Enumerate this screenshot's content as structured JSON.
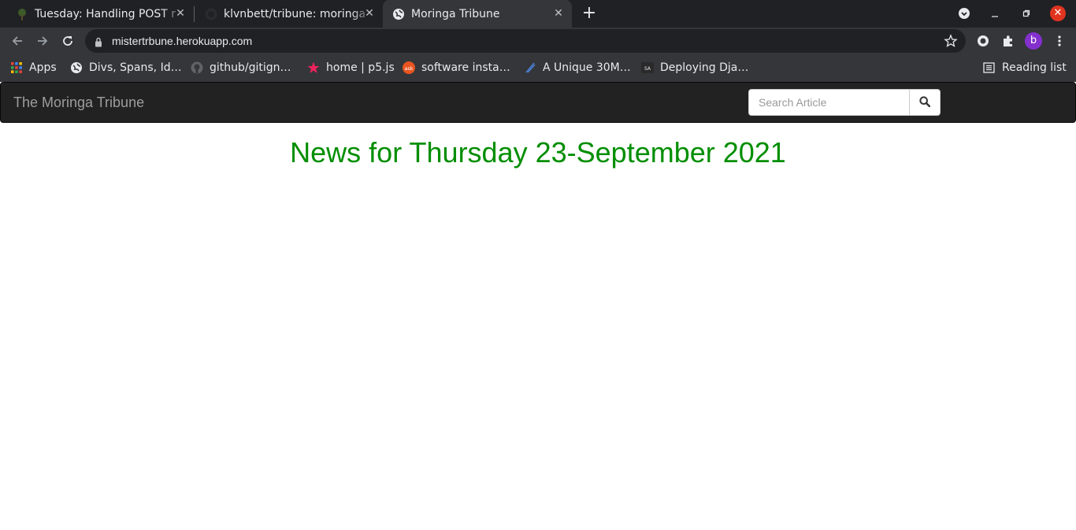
{
  "browser": {
    "tabs": [
      {
        "title": "Tuesday: Handling POST r",
        "favicon": "tree-icon"
      },
      {
        "title": "klvnbett/tribune: moringa",
        "favicon": "github-icon"
      },
      {
        "title": "Moringa Tribune",
        "favicon": "globe-icon",
        "active": true
      }
    ],
    "url": "mistertrbune.herokuapp.com",
    "profile_initial": "b",
    "bookmarks": [
      {
        "label": "Apps",
        "icon": "apps-grid-icon"
      },
      {
        "label": "Divs, Spans, Id…",
        "icon": "globe-icon"
      },
      {
        "label": "github/gitign…",
        "icon": "github-icon"
      },
      {
        "label": "home | p5.js",
        "icon": "star-icon"
      },
      {
        "label": "software insta…",
        "icon": "ask-icon"
      },
      {
        "label": "A Unique 30M…",
        "icon": "pen-icon"
      },
      {
        "label": "Deploying Dja…",
        "icon": "sa-icon"
      }
    ],
    "reading_list": "Reading list",
    "colors": {
      "tabbar": "#202124",
      "toolbar": "#35363a",
      "profile": "#8430ce",
      "close": "#e0341f"
    }
  },
  "site": {
    "brand": "The Moringa Tribune",
    "search_placeholder": "Search Article",
    "headline": "News for Thursday 23-September 2021",
    "colors": {
      "navbar": "#222222",
      "headline": "#008e00"
    }
  }
}
